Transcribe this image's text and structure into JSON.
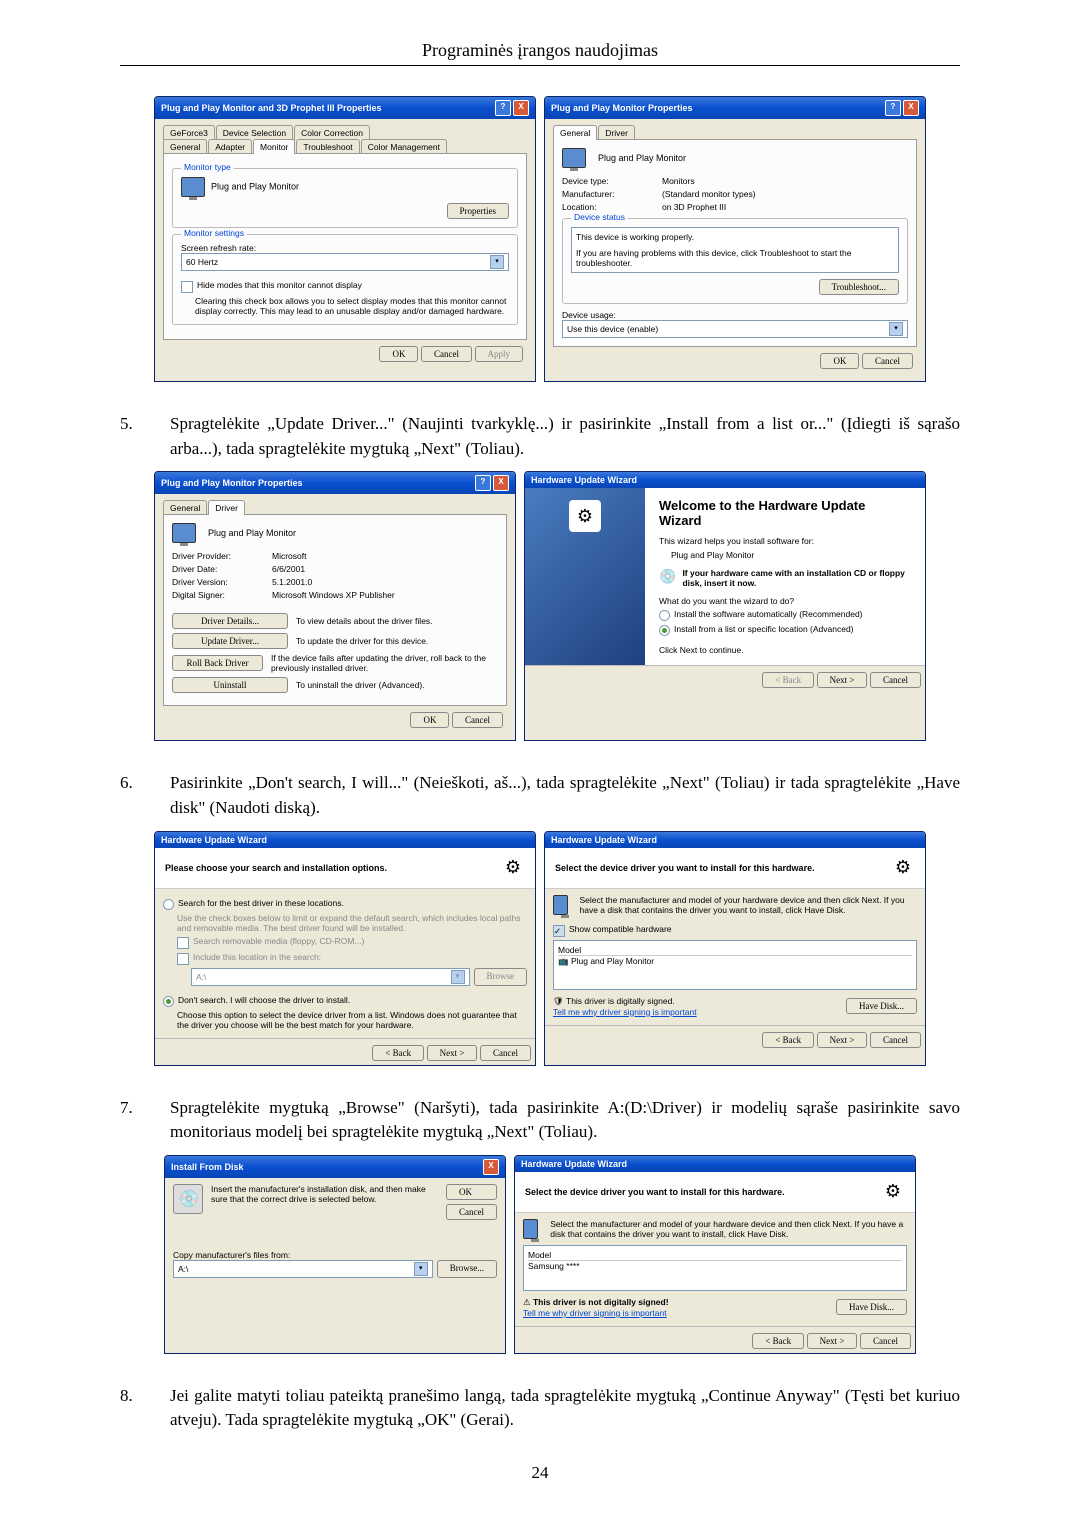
{
  "header": {
    "title": "Programinės įrangos naudojimas"
  },
  "page_number": "24",
  "steps": {
    "s5": {
      "num": "5.",
      "text": "Spragtelėkite „Update Driver...\" (Naujinti tvarkyklę...) ir pasirinkite „Install from a list or...\" (Įdiegti iš sąrašo arba...), tada spragtelėkite mygtuką „Next\" (Toliau)."
    },
    "s6": {
      "num": "6.",
      "text": "Pasirinkite „Don't search, I will...\" (Neieškoti, aš...), tada spragtelėkite „Next\" (Toliau) ir tada spragtelėkite „Have disk\" (Naudoti diską)."
    },
    "s7": {
      "num": "7.",
      "text": "Spragtelėkite mygtuką „Browse\" (Naršyti), tada pasirinkite A:(D:\\Driver) ir modelių sąraše pasirinkite savo monitoriaus modelį bei spragtelėkite mygtuką „Next\" (Toliau)."
    },
    "s8": {
      "num": "8.",
      "text": "Jei galite matyti toliau pateiktą pranešimo langą, tada spragtelėkite mygtuką „Continue Anyway\" (Tęsti bet kuriuo atveju). Tada spragtelėkite mygtuką „OK\" (Gerai)."
    }
  },
  "win": {
    "title_btn_close": "X",
    "title_btn_help": "?",
    "ok": "OK",
    "cancel": "Cancel",
    "apply": "Apply",
    "back": "< Back",
    "next": "Next >"
  },
  "dlg1": {
    "title": "Plug and Play Monitor and 3D Prophet III Properties",
    "tabs": {
      "geforce": "GeForce3",
      "devsel": "Device Selection",
      "colorcorr": "Color Correction",
      "general": "General",
      "adapter": "Adapter",
      "monitor": "Monitor",
      "trouble": "Troubleshoot",
      "colorman": "Color Management"
    },
    "monitor_type_label": "Monitor type",
    "monitor_name": "Plug and Play Monitor",
    "properties_btn": "Properties",
    "monitor_settings_label": "Monitor settings",
    "refresh_label": "Screen refresh rate:",
    "refresh_value": "60 Hertz",
    "hide_modes": "Hide modes that this monitor cannot display",
    "hide_desc": "Clearing this check box allows you to select display modes that this monitor cannot display correctly. This may lead to an unusable display and/or damaged hardware."
  },
  "dlg2": {
    "title": "Plug and Play Monitor Properties",
    "tab_general": "General",
    "tab_driver": "Driver",
    "heading": "Plug and Play Monitor",
    "devtype_l": "Device type:",
    "devtype_v": "Monitors",
    "manuf_l": "Manufacturer:",
    "manuf_v": "(Standard monitor types)",
    "loc_l": "Location:",
    "loc_v": "on 3D Prophet III",
    "status_label": "Device status",
    "status1": "This device is working properly.",
    "status2": "If you are having problems with this device, click Troubleshoot to start the troubleshooter.",
    "troubleshoot": "Troubleshoot...",
    "usage_label": "Device usage:",
    "usage_value": "Use this device (enable)"
  },
  "dlg3": {
    "title": "Plug and Play Monitor Properties",
    "tab_general": "General",
    "tab_driver": "Driver",
    "heading": "Plug and Play Monitor",
    "prov_l": "Driver Provider:",
    "prov_v": "Microsoft",
    "date_l": "Driver Date:",
    "date_v": "6/6/2001",
    "ver_l": "Driver Version:",
    "ver_v": "5.1.2001.0",
    "sig_l": "Digital Signer:",
    "sig_v": "Microsoft Windows XP Publisher",
    "details_btn": "Driver Details...",
    "details_txt": "To view details about the driver files.",
    "update_btn": "Update Driver...",
    "update_txt": "To update the driver for this device.",
    "rollback_btn": "Roll Back Driver",
    "rollback_txt": "If the device fails after updating the driver, roll back to the previously installed driver.",
    "uninstall_btn": "Uninstall",
    "uninstall_txt": "To uninstall the driver (Advanced)."
  },
  "dlg4": {
    "title": "Hardware Update Wizard",
    "welcome": "Welcome to the Hardware Update Wizard",
    "helps": "This wizard helps you install software for:",
    "device": "Plug and Play Monitor",
    "cd_hint": "If your hardware came with an installation CD or floppy disk, insert it now.",
    "what_do": "What do you want the wizard to do?",
    "opt_auto": "Install the software automatically (Recommended)",
    "opt_list": "Install from a list or specific location (Advanced)",
    "click_next": "Click Next to continue."
  },
  "dlg5": {
    "title": "Hardware Update Wizard",
    "header": "Please choose your search and installation options.",
    "opt_search": "Search for the best driver in these locations.",
    "opt_search_desc": "Use the check boxes below to limit or expand the default search, which includes local paths and removable media. The best driver found will be installed.",
    "chk_removable": "Search removable media (floppy, CD-ROM...)",
    "chk_include": "Include this location in the search:",
    "path": "A:\\",
    "browse": "Browse",
    "opt_dont": "Don't search. I will choose the driver to install.",
    "opt_dont_desc": "Choose this option to select the device driver from a list. Windows does not guarantee that the driver you choose will be the best match for your hardware."
  },
  "dlg6": {
    "title": "Hardware Update Wizard",
    "header": "Select the device driver you want to install for this hardware.",
    "desc": "Select the manufacturer and model of your hardware device and then click Next. If you have a disk that contains the driver you want to install, click Have Disk.",
    "show_compat": "Show compatible hardware",
    "model_label": "Model",
    "model_item": "Plug and Play Monitor",
    "signed": "This driver is digitally signed.",
    "tell_me": "Tell me why driver signing is important",
    "have_disk": "Have Disk..."
  },
  "dlg7": {
    "title": "Install From Disk",
    "instr": "Insert the manufacturer's installation disk, and then make sure that the correct drive is selected below.",
    "copy_label": "Copy manufacturer's files from:",
    "path": "A:\\",
    "browse": "Browse..."
  },
  "dlg8": {
    "title": "Hardware Update Wizard",
    "header": "Select the device driver you want to install for this hardware.",
    "desc": "Select the manufacturer and model of your hardware device and then click Next. If you have a disk that contains the driver you want to install, click Have Disk.",
    "model_label": "Model",
    "model_item": "Samsung ****",
    "not_signed": "This driver is not digitally signed!",
    "tell_me": "Tell me why driver signing is important",
    "have_disk": "Have Disk..."
  }
}
